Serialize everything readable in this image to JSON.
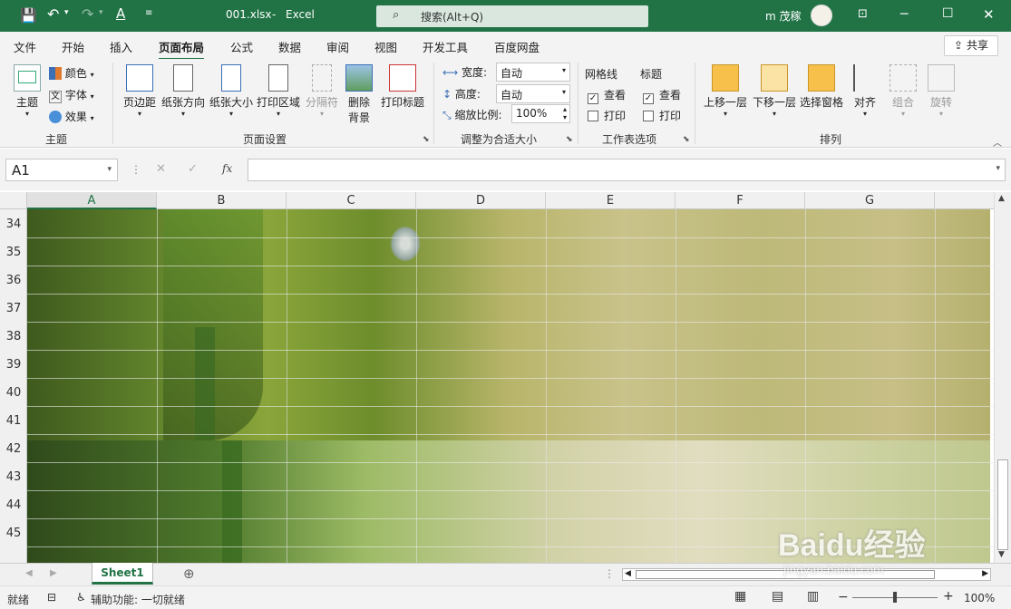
{
  "titlebar": {
    "filename": "001.xlsx",
    "separator": "-",
    "app": "Excel",
    "search_placeholder": "搜索(Alt+Q)",
    "user": "m 茂稼"
  },
  "menu": {
    "tabs": [
      "文件",
      "开始",
      "插入",
      "页面布局",
      "公式",
      "数据",
      "审阅",
      "视图",
      "开发工具",
      "百度网盘"
    ],
    "active": "页面布局",
    "share": "共享"
  },
  "ribbon": {
    "theme": {
      "main": "主题",
      "colors": "颜色",
      "fonts": "字体",
      "effects": "效果",
      "group": "主题"
    },
    "page_setup": {
      "margins": "页边距",
      "orientation": "纸张方向",
      "size": "纸张大小",
      "print_area": "打印区域",
      "breaks": "分隔符",
      "delete_bg_1": "删除",
      "delete_bg_2": "背景",
      "print_titles": "打印标题",
      "group": "页面设置"
    },
    "scale": {
      "width_label": "宽度:",
      "width_value": "自动",
      "height_label": "高度:",
      "height_value": "自动",
      "scale_label": "缩放比例:",
      "scale_value": "100%",
      "group": "调整为合适大小"
    },
    "sheet_options": {
      "gridlines": "网格线",
      "headings": "标题",
      "view": "查看",
      "print": "打印",
      "group": "工作表选项"
    },
    "arrange": {
      "bring_forward": "上移一层",
      "send_backward": "下移一层",
      "selection_pane": "选择窗格",
      "align": "对齐",
      "group_btn": "组合",
      "rotate": "旋转",
      "group": "排列"
    }
  },
  "formula": {
    "namebox": "A1",
    "fx": "fx"
  },
  "grid": {
    "columns": [
      "A",
      "B",
      "C",
      "D",
      "E",
      "F",
      "G"
    ],
    "rows": [
      "34",
      "35",
      "36",
      "37",
      "38",
      "39",
      "40",
      "41",
      "42",
      "43",
      "44",
      "45"
    ]
  },
  "sheets": {
    "tabs": [
      "Sheet1"
    ]
  },
  "status": {
    "ready": "就绪",
    "accessibility": "辅助功能: 一切就绪",
    "zoom": "100%"
  },
  "watermark": {
    "brand": "Baidu经验",
    "url": "jingyan.baidu.com"
  }
}
